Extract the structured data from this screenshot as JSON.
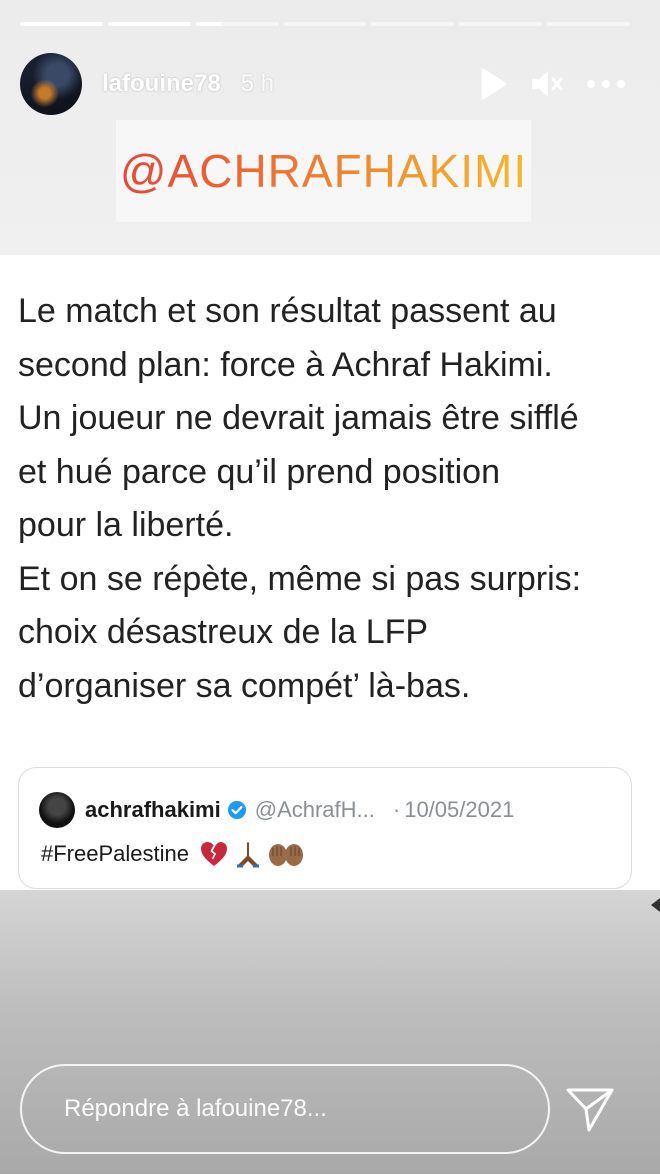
{
  "story": {
    "progress": [
      1,
      1,
      0.3,
      0,
      0,
      0,
      0
    ]
  },
  "header": {
    "username": "lafouine78",
    "time": "5 h",
    "icons": {
      "play": "play-icon",
      "mute": "mute-icon",
      "more": "more-options-icon"
    }
  },
  "sticker": {
    "mention": "@ACHRAFHAKIMI"
  },
  "post": {
    "text": "Le match et son résultat passent au\nsecond plan: force à Achraf Hakimi.\nUn joueur ne devrait jamais être sifflé\net hué parce qu’il prend position\npour la liberté.\nEt on se répète, même si pas surpris:\nchoix désastreux de la LFP\nd’organiser sa compét’ là-bas."
  },
  "tweet": {
    "name": "achrafhakimi",
    "handle": "@AchrafH...",
    "separator": "·",
    "date": "10/05/2021",
    "text": "#FreePalestine",
    "emojis": [
      "broken-heart",
      "praying-hands",
      "open-hands"
    ]
  },
  "reply": {
    "placeholder": "Répondre à lafouine78..."
  },
  "colors": {
    "mention_gradient": [
      "#e4473a",
      "#ee7a31",
      "#f5b82e"
    ],
    "verified": "#1d9bf0"
  }
}
